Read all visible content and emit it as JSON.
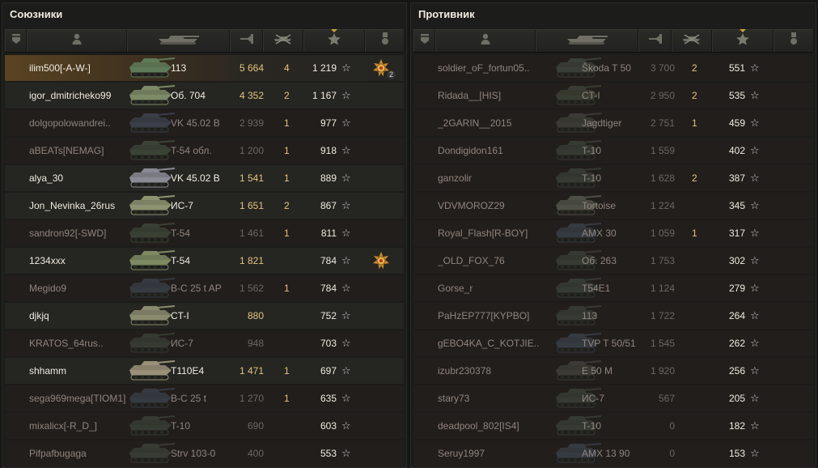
{
  "allies": {
    "title": "Союзники",
    "players": [
      {
        "name": "ilim500[-A-W-]",
        "tank": "113",
        "damage": "5 664",
        "kills": "4",
        "xp": "1 219",
        "alive": true,
        "self": true,
        "medal": true,
        "medal_count": "2",
        "tank_tint": "#5f7a58"
      },
      {
        "name": "igor_dmitricheko99",
        "tank": "Об. 704",
        "damage": "4 352",
        "kills": "2",
        "xp": "1 167",
        "alive": true,
        "tank_tint": "#7c8a66"
      },
      {
        "name": "dolgopolowandrei..",
        "tank": "VK 45.02 B",
        "damage": "2 939",
        "kills": "1",
        "xp": "977",
        "alive": false,
        "tank_tint": "#3e4450"
      },
      {
        "name": "aBEATs[NEMAG]",
        "tank": "T-54 обл.",
        "damage": "1 200",
        "kills": "1",
        "xp": "918",
        "alive": false,
        "tank_tint": "#404a3c"
      },
      {
        "name": "alya_30",
        "tank": "VK 45.02 B",
        "damage": "1 541",
        "kills": "1",
        "xp": "889",
        "alive": true,
        "tank_tint": "#8a8a94"
      },
      {
        "name": "Jon_Nevinka_26rus",
        "tank": "ИС-7",
        "damage": "1 651",
        "kills": "2",
        "xp": "867",
        "alive": true,
        "tank_tint": "#8d9270"
      },
      {
        "name": "sandron92[-SWD]",
        "tank": "T-54",
        "damage": "1 461",
        "kills": "1",
        "xp": "811",
        "alive": false,
        "tank_tint": "#3e4638"
      },
      {
        "name": "1234xxx",
        "tank": "T-54",
        "damage": "1 821",
        "kills": "",
        "xp": "784",
        "alive": true,
        "medal": true,
        "tank_tint": "#7d8a62"
      },
      {
        "name": "Megido9",
        "tank": "B-C 25 t AP",
        "damage": "1 562",
        "kills": "1",
        "xp": "784",
        "alive": false,
        "tank_tint": "#3a3f48"
      },
      {
        "name": "djkjq",
        "tank": "CT-I",
        "damage": "880",
        "kills": "",
        "xp": "752",
        "alive": true,
        "tank_tint": "#8a8a6e"
      },
      {
        "name": "KRATOS_64rus..",
        "tank": "ИС-7",
        "damage": "948",
        "kills": "",
        "xp": "703",
        "alive": false,
        "tank_tint": "#3a4036"
      },
      {
        "name": "shhamm",
        "tank": "T110E4",
        "damage": "1 471",
        "kills": "1",
        "xp": "697",
        "alive": true,
        "tank_tint": "#9a9078"
      },
      {
        "name": "sega969mega[TIOM1]",
        "tank": "B-C 25 t",
        "damage": "1 270",
        "kills": "1",
        "xp": "635",
        "alive": false,
        "tank_tint": "#3a3f48"
      },
      {
        "name": "mixalicx[-R_D_]",
        "tank": "T-10",
        "damage": "690",
        "kills": "",
        "xp": "603",
        "alive": false,
        "tank_tint": "#394036"
      },
      {
        "name": "Pifpafbugaga",
        "tank": "Strv 103-0",
        "damage": "400",
        "kills": "",
        "xp": "553",
        "alive": false,
        "tank_tint": "#3c4138"
      }
    ]
  },
  "enemies": {
    "title": "Противник",
    "players": [
      {
        "name": "soldier_oF_fortun05..",
        "tank": "Škoda T 50",
        "damage": "3 700",
        "kills": "2",
        "xp": "551",
        "alive": false,
        "tank_tint": "#3f443e"
      },
      {
        "name": "Ridada__[HIS]",
        "tank": "CT-I",
        "damage": "2 950",
        "kills": "2",
        "xp": "535",
        "alive": false,
        "tank_tint": "#3e4236"
      },
      {
        "name": "_2GARIN__2015",
        "tank": "Jagdtiger",
        "damage": "2 751",
        "kills": "1",
        "xp": "459",
        "alive": false,
        "tank_tint": "#40403a"
      },
      {
        "name": "Dondigidon161",
        "tank": "T-10",
        "damage": "1 559",
        "kills": "",
        "xp": "402",
        "alive": false,
        "tank_tint": "#3a3f38"
      },
      {
        "name": "ganzolir",
        "tank": "T-10",
        "damage": "1 628",
        "kills": "2",
        "xp": "387",
        "alive": false,
        "tank_tint": "#3a3f38"
      },
      {
        "name": "VDVMOROZ29",
        "tank": "Tortoise",
        "damage": "1 224",
        "kills": "",
        "xp": "345",
        "alive": false,
        "tank_tint": "#55574e"
      },
      {
        "name": "Royal_Flash[R-BOY]",
        "tank": "AMX 30",
        "damage": "1 059",
        "kills": "1",
        "xp": "317",
        "alive": false,
        "tank_tint": "#3a3f48"
      },
      {
        "name": "_OLD_FOX_76",
        "tank": "Об. 263",
        "damage": "1 753",
        "kills": "",
        "xp": "302",
        "alive": false,
        "tank_tint": "#3a4036"
      },
      {
        "name": "Gorse_r",
        "tank": "T54E1",
        "damage": "1 124",
        "kills": "",
        "xp": "279",
        "alive": false,
        "tank_tint": "#3a3f3a"
      },
      {
        "name": "PaHzEP777[KYPBO]",
        "tank": "113",
        "damage": "1 722",
        "kills": "",
        "xp": "264",
        "alive": false,
        "tank_tint": "#3a3f38"
      },
      {
        "name": "gEBO4KA_C_KOTJIE..",
        "tank": "TVP T 50/51",
        "damage": "1 545",
        "kills": "",
        "xp": "262",
        "alive": false,
        "tank_tint": "#3a3f48"
      },
      {
        "name": "izubr230378",
        "tank": "E 50 M",
        "damage": "1 920",
        "kills": "",
        "xp": "256",
        "alive": false,
        "tank_tint": "#40403a"
      },
      {
        "name": "stary73",
        "tank": "ИС-7",
        "damage": "567",
        "kills": "",
        "xp": "205",
        "alive": false,
        "tank_tint": "#3a4036"
      },
      {
        "name": "deadpool_802[IS4]",
        "tank": "T-10",
        "damage": "0",
        "kills": "",
        "xp": "182",
        "alive": false,
        "tank_tint": "#3a3f38"
      },
      {
        "name": "Seruy1997",
        "tank": "AMX 13 90",
        "damage": "0",
        "kills": "",
        "xp": "153",
        "alive": false,
        "tank_tint": "#3a3f48"
      }
    ]
  },
  "header_icons": [
    "platoon-icon",
    "player-icon",
    "tank-icon",
    "damage-icon",
    "kills-icon",
    "xp-star-icon",
    "medal-icon"
  ],
  "star_glyph": "☆",
  "colors": {
    "alive_text": "#f0ece0",
    "dead_text": "#8f857e",
    "highlight_value": "#e3c47f",
    "self_row": "#5a4322",
    "sort_marker": "#c9a23a"
  }
}
